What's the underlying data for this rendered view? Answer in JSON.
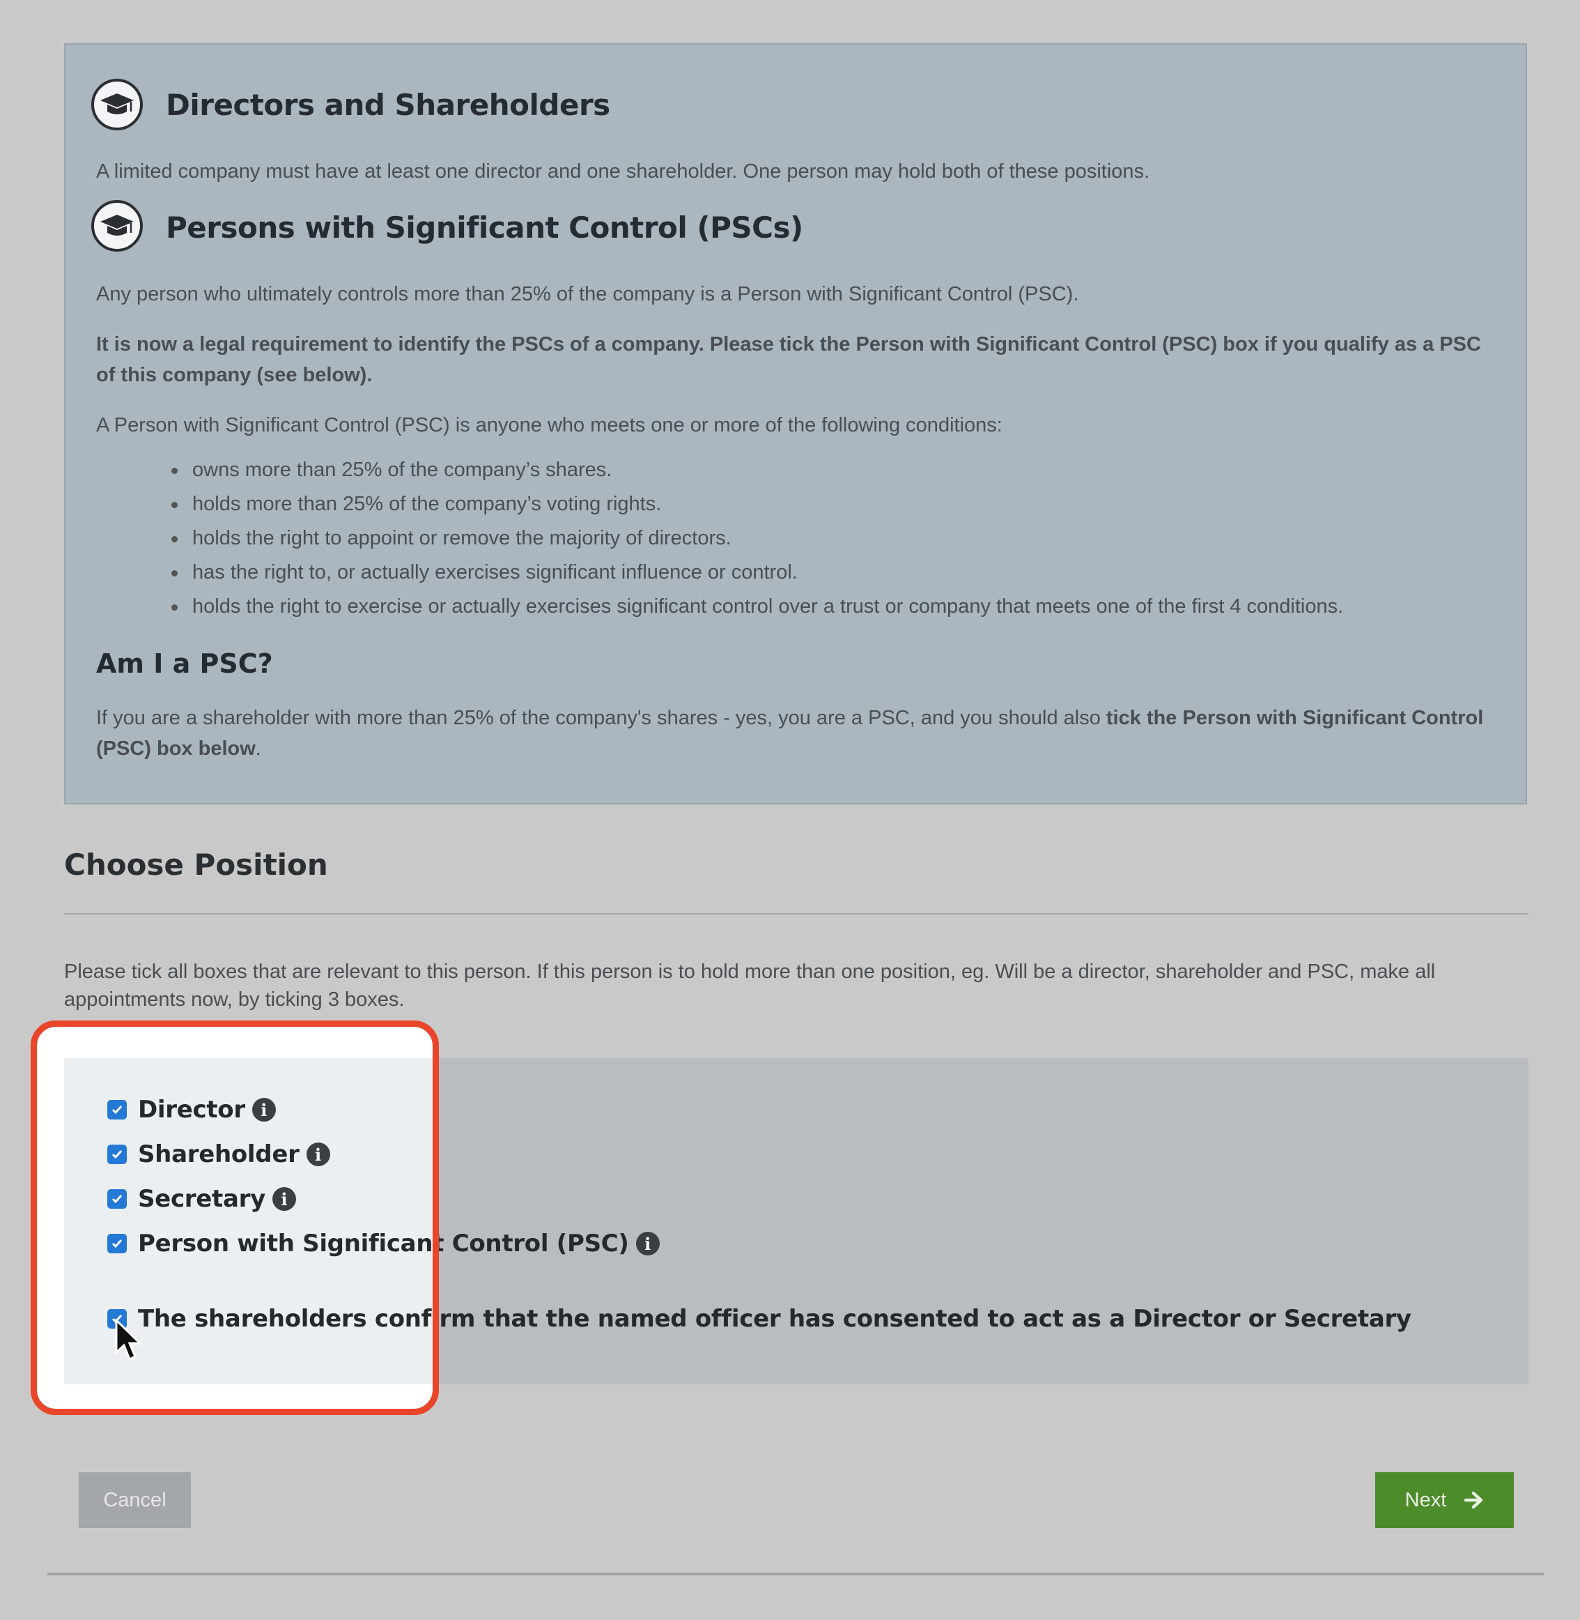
{
  "info": {
    "directors": {
      "heading": "Directors and Shareholders",
      "text": "A limited company must have at least one director and one shareholder. One person may hold both of these positions."
    },
    "psc": {
      "heading": "Persons with Significant Control (PSCs)",
      "intro": "Any person who ultimately controls more than 25% of the company is a Person with Significant Control (PSC).",
      "legal_notice": "It is now a legal requirement to identify the PSCs of a company. Please tick the Person with Significant Control (PSC) box if you qualify as a PSC of this company (see below).",
      "conditions_intro": "A Person with Significant Control (PSC) is anyone who meets one or more of the following conditions:",
      "conditions": [
        "owns more than 25% of the company’s shares.",
        "holds more than 25% of the company’s voting rights.",
        "holds the right to appoint or remove the majority of directors.",
        "has the right to, or actually exercises significant influence or control.",
        "holds the right to exercise or actually exercises significant control over a trust or company that meets one of the first 4 conditions."
      ]
    },
    "am_i_psc": {
      "heading": "Am I a PSC?",
      "text_plain": "If you are a shareholder with more than 25% of the company's shares - yes, you are a PSC, and you should also ",
      "text_bold": "tick the Person with Significant Control (PSC) box below",
      "text_end": "."
    }
  },
  "choose_position": {
    "title": "Choose Position",
    "instructions": "Please tick all boxes that are relevant to this person. If this person is to hold more than one position, eg. Will be a director, shareholder and PSC, make all appointments now, by ticking 3 boxes.",
    "options": [
      {
        "label": "Director",
        "checked": true
      },
      {
        "label": "Shareholder",
        "checked": true
      },
      {
        "label": "Secretary",
        "checked": true
      },
      {
        "label": "Person with Significant Control (PSC)",
        "checked": true
      }
    ],
    "consent": {
      "label": "The shareholders confirm that the named officer has consented to act as a Director or Secretary",
      "checked": true
    }
  },
  "buttons": {
    "cancel": "Cancel",
    "next": "Next"
  },
  "colors": {
    "highlight": "#e8452a",
    "checkbox": "#2478d6",
    "next_button": "#4c8c2a",
    "info_panel": "#abb6be"
  },
  "icons": [
    "graduation-cap-icon",
    "info-circle-icon",
    "check-icon",
    "arrow-right-icon",
    "mouse-cursor-icon"
  ]
}
